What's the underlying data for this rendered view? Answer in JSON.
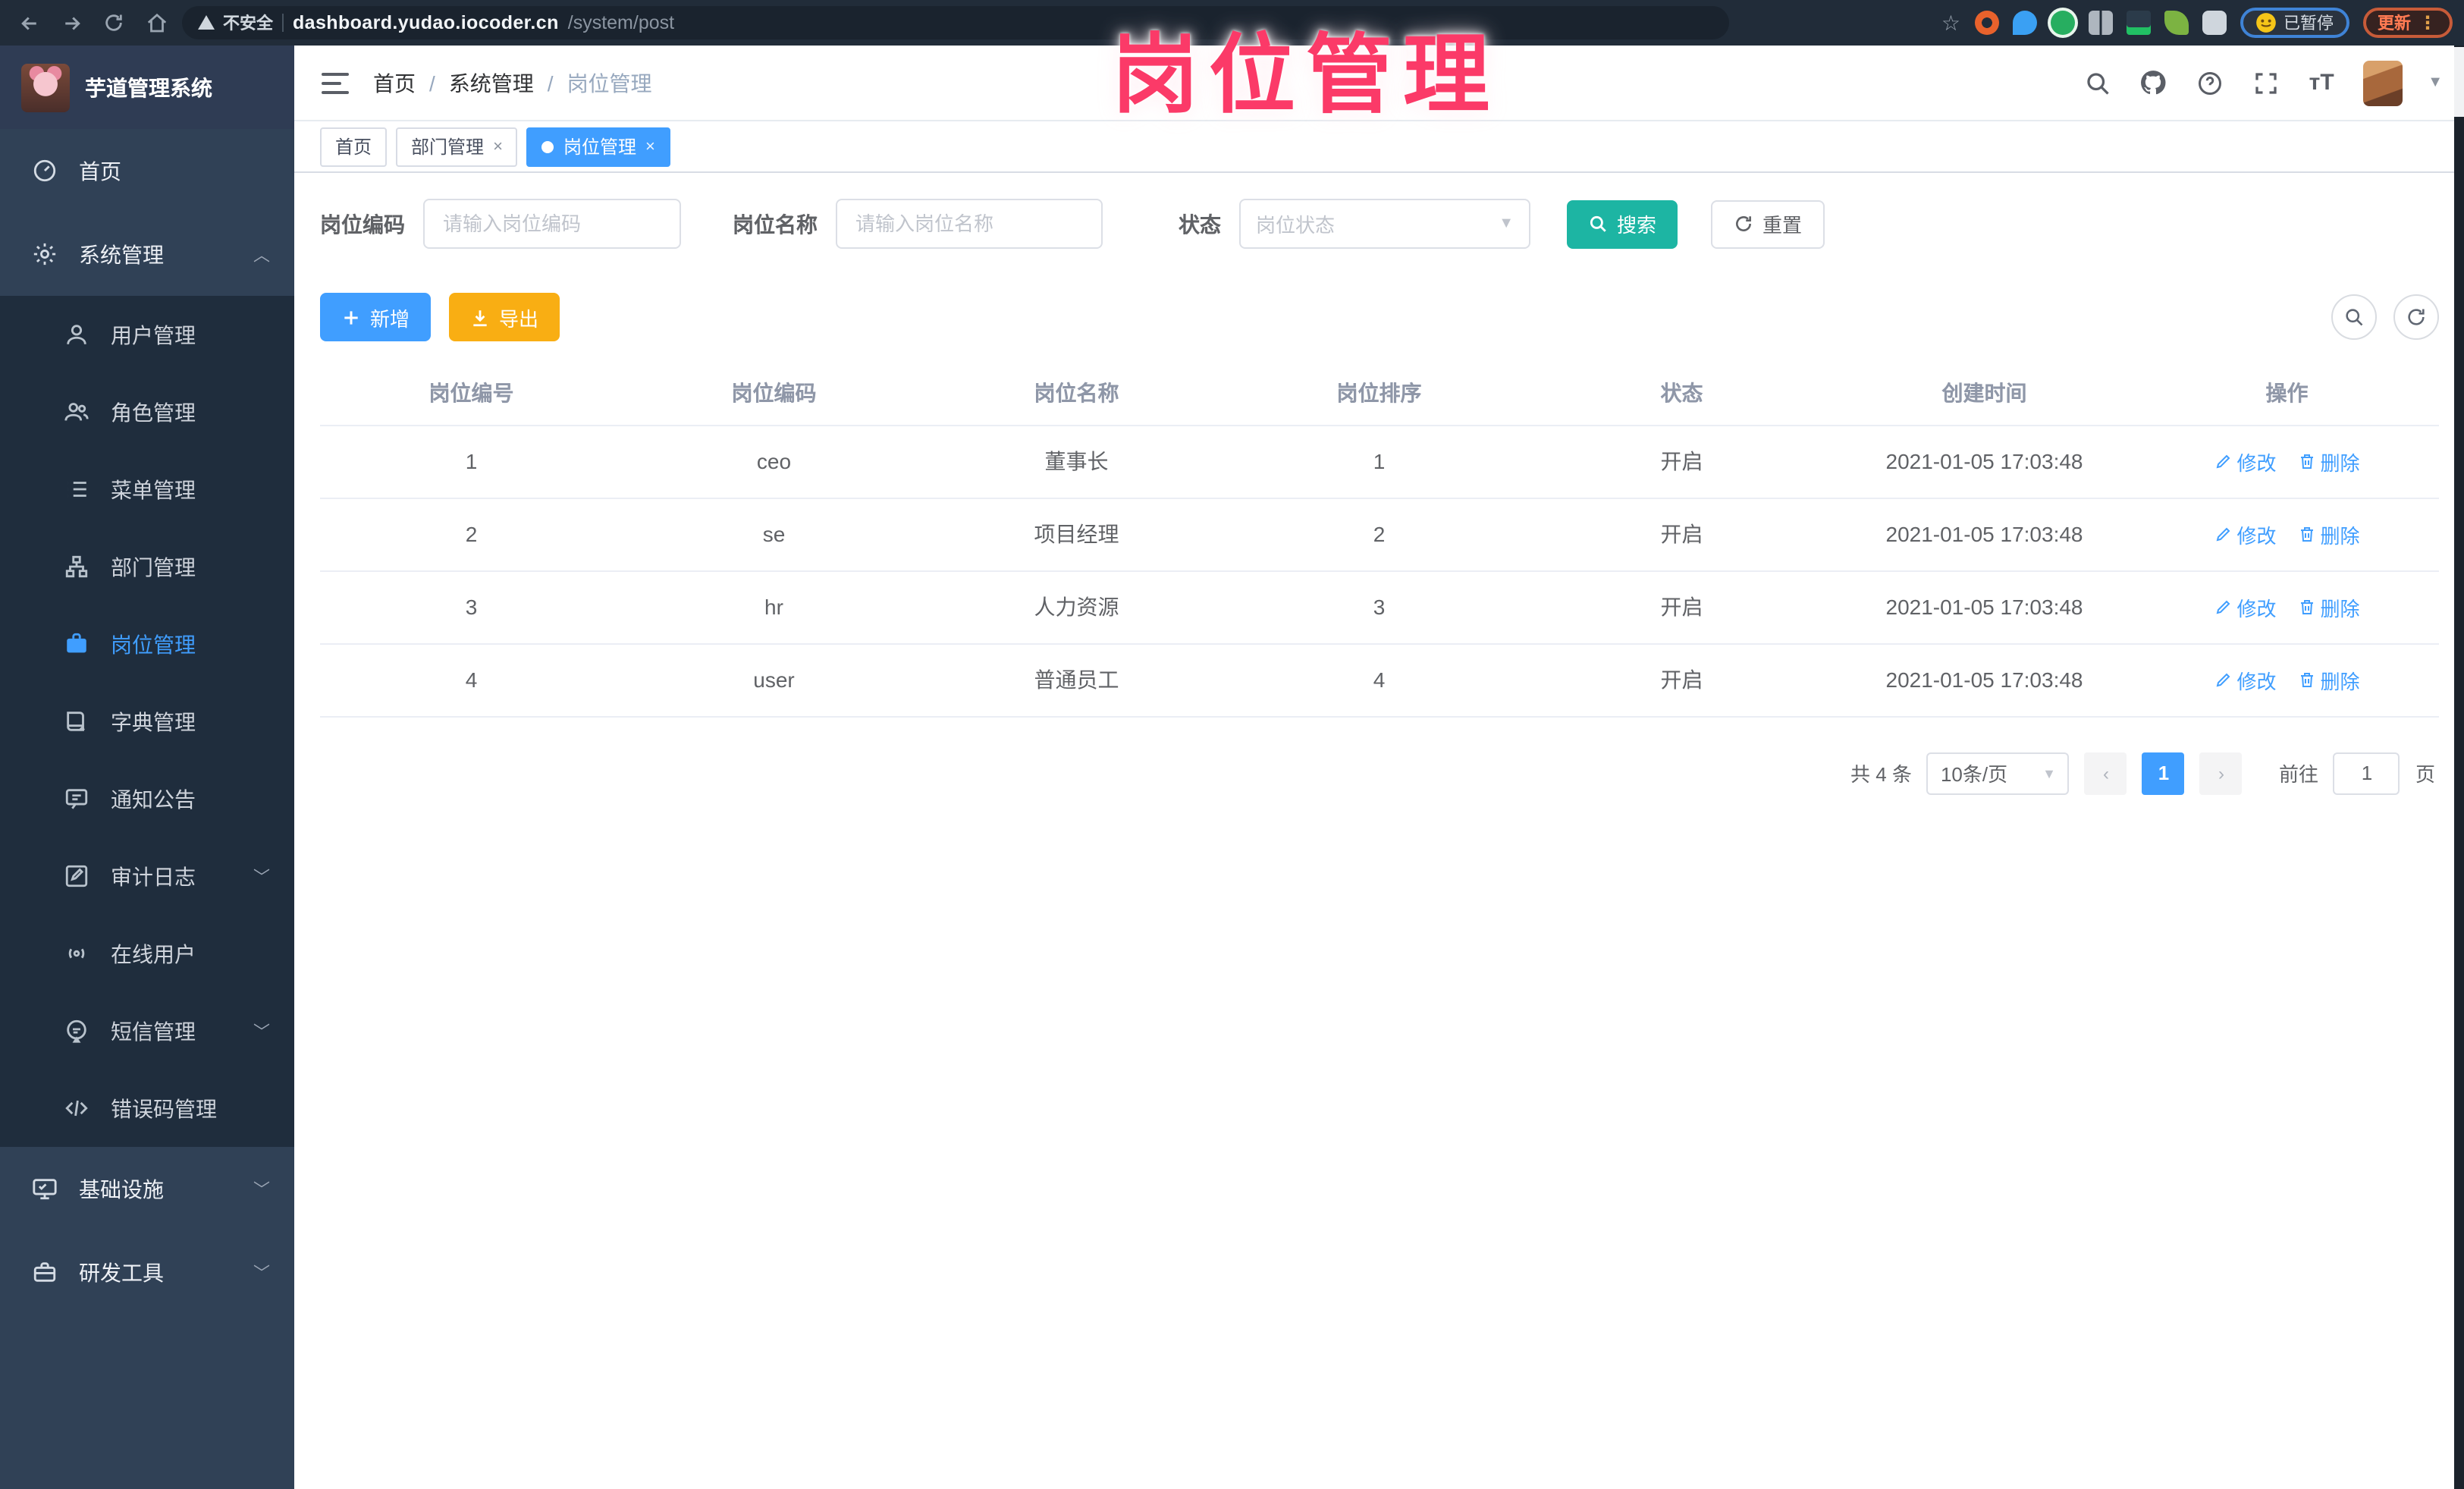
{
  "browser": {
    "warning": "不安全",
    "host": "dashboard.yudao.iocoder.cn",
    "path": "/system/post",
    "paused_badge": "已暂停",
    "update_button": "更新"
  },
  "overlay_title": "岗位管理",
  "sidebar": {
    "app_title": "芋道管理系统",
    "root": [
      {
        "label": "首页"
      },
      {
        "label": "系统管理"
      }
    ],
    "system_children": [
      "用户管理",
      "角色管理",
      "菜单管理",
      "部门管理",
      "岗位管理",
      "字典管理",
      "通知公告",
      "审计日志",
      "在线用户",
      "短信管理",
      "错误码管理"
    ],
    "bottom": [
      "基础设施",
      "研发工具"
    ]
  },
  "header": {
    "breadcrumb": [
      "首页",
      "系统管理",
      "岗位管理"
    ]
  },
  "tabs": {
    "items": [
      {
        "label": "首页"
      },
      {
        "label": "部门管理"
      },
      {
        "label": "岗位管理"
      }
    ]
  },
  "filters": {
    "code_label": "岗位编码",
    "code_placeholder": "请输入岗位编码",
    "name_label": "岗位名称",
    "name_placeholder": "请输入岗位名称",
    "status_label": "状态",
    "status_placeholder": "岗位状态",
    "search_label": "搜索",
    "reset_label": "重置"
  },
  "toolbar": {
    "add_label": "新增",
    "export_label": "导出"
  },
  "table": {
    "headers": [
      "岗位编号",
      "岗位编码",
      "岗位名称",
      "岗位排序",
      "状态",
      "创建时间",
      "操作"
    ],
    "rows": [
      [
        "1",
        "ceo",
        "董事长",
        "1",
        "开启",
        "2021-01-05 17:03:48"
      ],
      [
        "2",
        "se",
        "项目经理",
        "2",
        "开启",
        "2021-01-05 17:03:48"
      ],
      [
        "3",
        "hr",
        "人力资源",
        "3",
        "开启",
        "2021-01-05 17:03:48"
      ],
      [
        "4",
        "user",
        "普通员工",
        "4",
        "开启",
        "2021-01-05 17:03:48"
      ]
    ],
    "edit_label": "修改",
    "delete_label": "删除"
  },
  "pagination": {
    "total": "共 4 条",
    "page_size": "10条/页",
    "page": "1",
    "goto_label": "前往",
    "goto_value": "1",
    "unit_label": "页"
  },
  "colors": {
    "accent": "#409eff",
    "search_teal": "#1db5a3",
    "export_orange": "#f9ae13",
    "overlay_pink": "#fb3a68"
  }
}
